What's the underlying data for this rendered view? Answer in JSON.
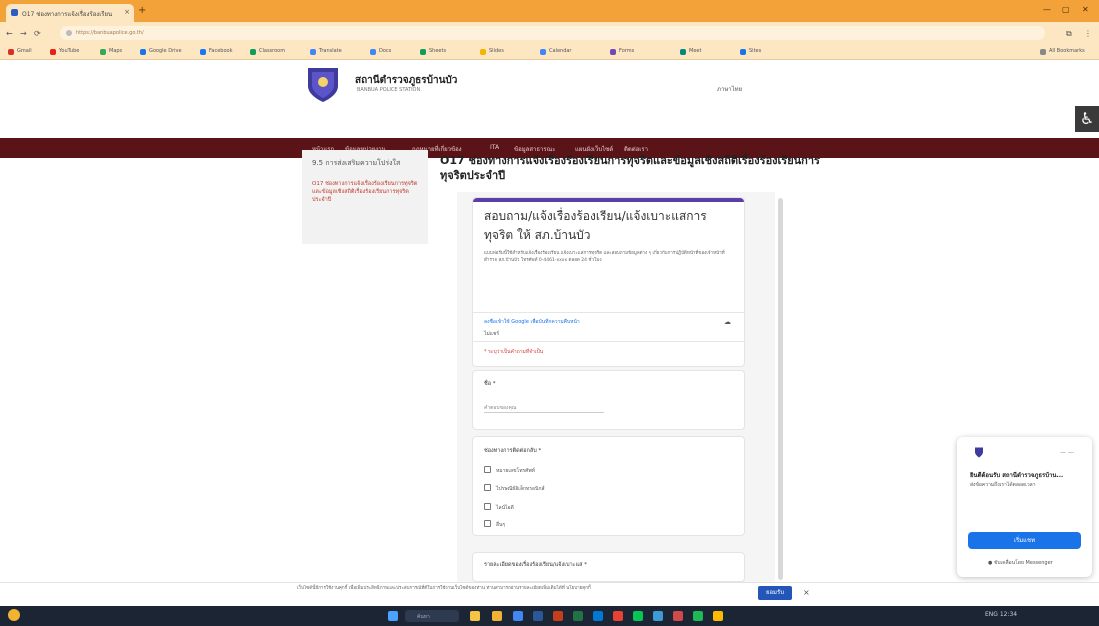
{
  "browser": {
    "tab_title": "O17 ช่องทางการแจ้งเรื่องร้องเรียน",
    "url": "https://banbuapolice.go.th/",
    "bookmarks": [
      "Gmail",
      "YouTube",
      "Maps",
      "Google Drive",
      "Facebook",
      "Classroom",
      "Translate",
      "Docs",
      "Sheets",
      "Slides",
      "Calendar",
      "Forms",
      "Meet",
      "Sites",
      "All Bookmarks"
    ]
  },
  "site": {
    "title": "สถานีตำรวจภูธรบ้านบัว",
    "subtitle": "BANBUA POLICE STATION",
    "lang": "ภาษาไทย",
    "accessibility_icon": "wheelchair-icon",
    "nav": [
      "หน้าแรก",
      "ข้อมูลหน่วยงาน",
      "กฎหมายที่เกี่ยวข้อง",
      "ITA",
      "ข้อมูลสาธารณะ",
      "แผนผังเว็บไซต์",
      "ติดต่อเรา"
    ]
  },
  "sidebar": {
    "title": "9.5 การส่งเสริมความโปร่งใส",
    "item": "O17 ช่องทางการแจ้งเรื่องร้องเรียนการทุจริตและข้อมูลเชิงสถิติเรื่องร้องเรียนการทุจริตประจำปี"
  },
  "page": {
    "title": "O17 ช่องทางการแจ้งเรื่องร้องเรียนการทุจริตและข้อมูลเชิงสถิติเรื่องร้องเรียนการทุจริตประจำปี"
  },
  "form": {
    "title": "สอบถาม/แจ้งเรื่องร้องเรียน/แจ้งเบาะแสการทุจริต ให้ สภ.บ้านบัว",
    "description": "แบบฟอร์มนี้ใช้สำหรับแจ้งเรื่องร้องเรียน แจ้งเบาะแสการทุจริต และสอบถามข้อมูลต่าง ๆ เกี่ยวกับการปฏิบัติหน้าที่ของเจ้าหน้าที่ตำรวจ สภ.บ้านบัว โทรศัพท์ 0-4461-xxxx ตลอด 24 ชั่วโมง",
    "account_text": "ลงชื่อเข้าใช้ Google เพื่อบันทึกความคืบหน้า",
    "not_shared": "ไม่แชร์",
    "required_note": "* ระบุว่าเป็นคำถามที่จำเป็น",
    "q1_label": "ชื่อ *",
    "q1_placeholder": "คำตอบของคุณ",
    "q2_label": "ช่องทางการติดต่อกลับ *",
    "q2_options": [
      "หมายเลขโทรศัพท์",
      "ไปรษณีย์อิเล็กทรอนิกส์",
      "ไลน์ไอดี",
      "อื่นๆ"
    ],
    "q3_label": "รายละเอียดของเรื่องร้องเรียน/แจ้งเบาะแส *"
  },
  "chat": {
    "name": "ยินดีต้อนรับ สถานีตำรวจภูธรบ้าน...",
    "message": "ส่งข้อความถึงเราได้ตลอดเวลา",
    "button": "เริ่มแชท",
    "footer": "ขับเคลื่อนโดย Messenger",
    "controls": "— —"
  },
  "cookie": {
    "text": "เว็บไซต์นี้มีการใช้งานคุกกี้ เพื่อเพิ่มประสิทธิภาพและประสบการณ์ที่ดีในการใช้งานเว็บไซต์ของท่าน ท่านสามารถอ่านรายละเอียดเพิ่มเติมได้ที่ นโยบายคุกกี้",
    "accept": "ยอมรับ",
    "close": "×"
  },
  "taskbar": {
    "search": "ค้นหา",
    "tray": "ENG  12:34"
  }
}
